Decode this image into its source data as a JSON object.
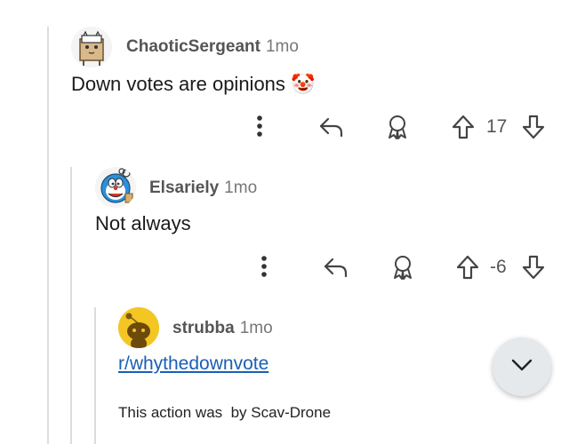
{
  "comments": [
    {
      "author": "ChaoticSergeant",
      "time": "1mo",
      "text": "Down votes are opinions",
      "emoji": "🤡",
      "score": "17",
      "avatar_icon": "cat-box-avatar-icon"
    },
    {
      "author": "Elsariely",
      "time": "1mo",
      "text": "Not always",
      "score": "-6",
      "avatar_icon": "doraemon-avatar-icon"
    },
    {
      "author": "strubba",
      "time": "1mo",
      "link": "r/whythedownvote",
      "note": "This action was  by Scav-Drone",
      "avatar_icon": "snoo-avatar-icon"
    }
  ],
  "icons": {
    "more": "more-vertical-icon",
    "reply": "reply-arrow-icon",
    "award": "award-icon",
    "upvote": "upvote-arrow-icon",
    "downvote": "downvote-arrow-icon",
    "scroll": "chevron-down-icon"
  },
  "colors": {
    "link": "#1a5fb4",
    "thread_line": "#dcdcdc",
    "fab_bg": "#e6e9ec",
    "snoo_bg": "#f3c623"
  }
}
